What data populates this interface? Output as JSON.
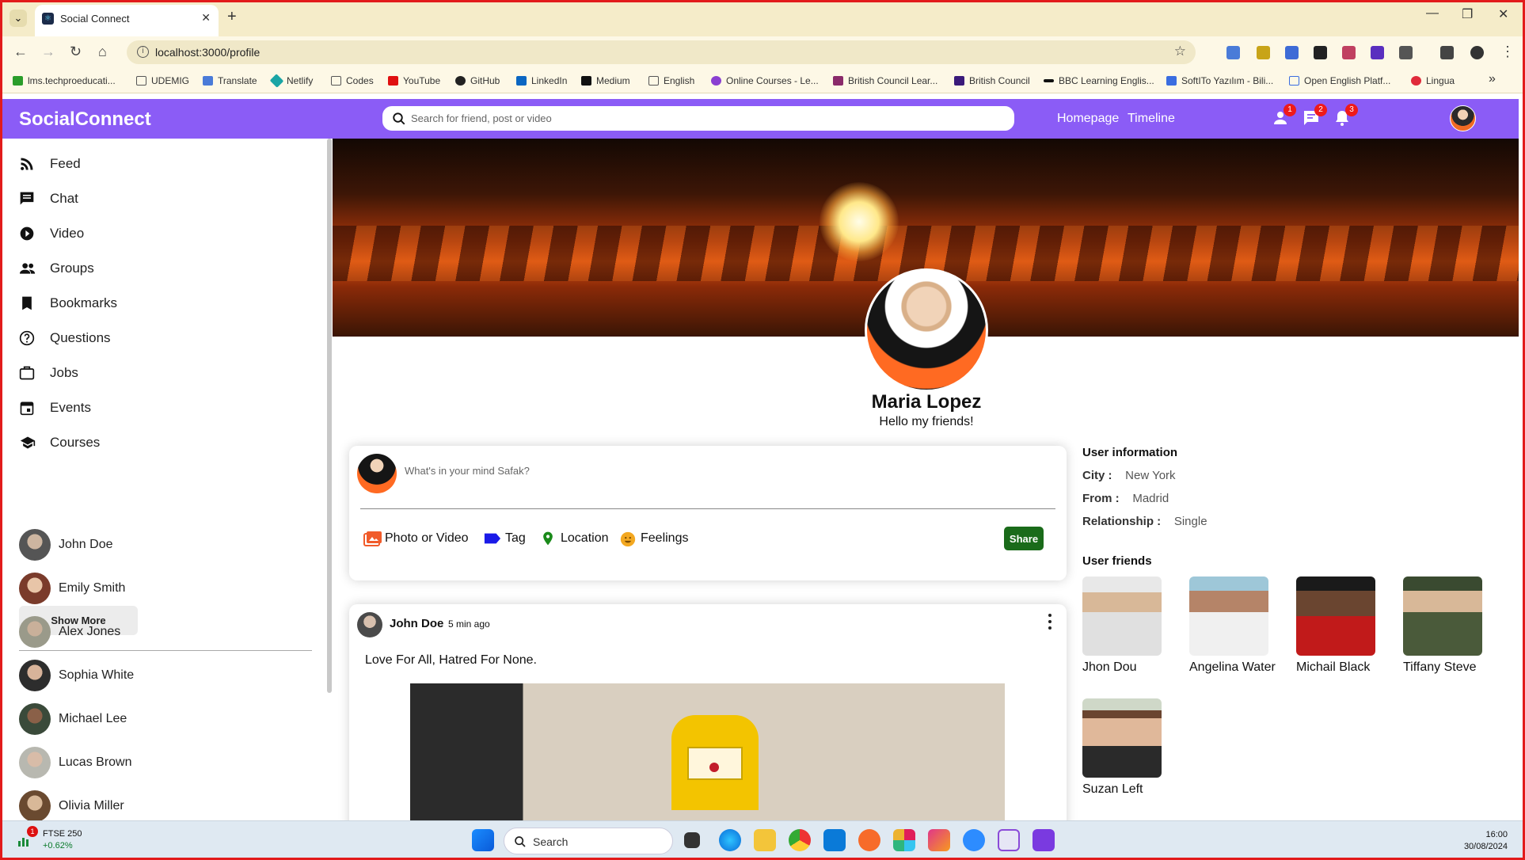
{
  "browser": {
    "tab_title": "Social Connect",
    "url": "localhost:3000/profile",
    "bookmarks": [
      "lms.techproeducati...",
      "UDEMIG",
      "Translate",
      "Netlify",
      "Codes",
      "YouTube",
      "GitHub",
      "LinkedIn",
      "Medium",
      "English",
      "Online Courses - Le...",
      "British Council Lear...",
      "British Council",
      "BBC Learning Englis...",
      "SoftITo Yazılım - Bili...",
      "Open English Platf...",
      "Lingua"
    ]
  },
  "header": {
    "logo": "SocialConnect",
    "search_placeholder": "Search for friend, post or video",
    "links": [
      "Homepage",
      "Timeline"
    ],
    "badges": [
      "1",
      "2",
      "3"
    ]
  },
  "sidebar": {
    "menu": [
      "Feed",
      "Chat",
      "Video",
      "Groups",
      "Bookmarks",
      "Questions",
      "Jobs",
      "Events",
      "Courses"
    ],
    "show_more": "Show More",
    "friends": [
      "John Doe",
      "Emily Smith",
      "Alex Jones",
      "Sophia White",
      "Michael Lee",
      "Lucas Brown",
      "Olivia Miller"
    ]
  },
  "profile": {
    "name": "Maria Lopez",
    "description": "Hello my friends!"
  },
  "share": {
    "placeholder": "What's in your mind Safak?",
    "options": [
      "Photo or Video",
      "Tag",
      "Location",
      "Feelings"
    ],
    "button": "Share"
  },
  "post": {
    "author": "John Doe",
    "time": "5 min ago",
    "text": "Love For All, Hatred For None."
  },
  "user_info": {
    "title": "User information",
    "rows": [
      {
        "label": "City :",
        "value": "New York"
      },
      {
        "label": "From :",
        "value": "Madrid"
      },
      {
        "label": "Relationship :",
        "value": "Single"
      }
    ]
  },
  "user_friends": {
    "title": "User friends",
    "names": [
      "Jhon Dou",
      "Angelina Water",
      "Michail Black",
      "Tiffany Steve",
      "Suzan Left"
    ]
  },
  "taskbar": {
    "stock_name": "FTSE 250",
    "stock_change": "+0.62%",
    "stock_badge": "1",
    "search": "Search",
    "time": "16:00",
    "date": "30/08/2024"
  },
  "colors": {
    "header": "#8b5cf6",
    "share_button": "#1a6b1a",
    "badge": "#ef1a1a"
  }
}
